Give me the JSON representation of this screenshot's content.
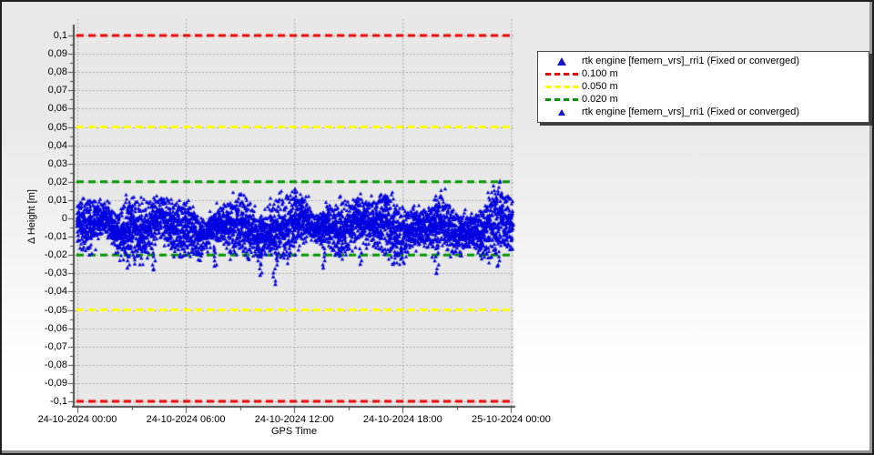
{
  "chart_data": {
    "type": "scatter",
    "title": "",
    "xlabel": "GPS Time",
    "ylabel": "Δ Height [m]",
    "x_ticks": [
      "24-10-2024 00:00",
      "24-10-2024 06:00",
      "24-10-2024 12:00",
      "24-10-2024 18:00",
      "25-10-2024 00:00"
    ],
    "x_range_hours": 24,
    "y_ticks": [
      "0,1",
      "0,09",
      "0,08",
      "0,07",
      "0,06",
      "0,05",
      "0,04",
      "0,03",
      "0,02",
      "0,01",
      "0",
      "-0,01",
      "-0,02",
      "-0,03",
      "-0,04",
      "-0,05",
      "-0,06",
      "-0,07",
      "-0,08",
      "-0,09",
      "-0,1"
    ],
    "ylim": [
      -0.1,
      0.1
    ],
    "y_step": 0.01,
    "grid": "dashed",
    "plot_bg": "#e8e8e8",
    "grid_color": "#a9a9a9",
    "axis_color": "#4d4d4d",
    "thresholds": [
      {
        "value": 0.1,
        "color": "#f00000",
        "label": "0.100 m"
      },
      {
        "value": 0.05,
        "color": "#ffff00",
        "label": "0.050 m"
      },
      {
        "value": 0.02,
        "color": "#009600",
        "label": "0.020 m"
      },
      {
        "value": -0.02,
        "color": "#009600",
        "label": "0.020 m"
      },
      {
        "value": -0.05,
        "color": "#ffff00",
        "label": "0.050 m"
      },
      {
        "value": -0.1,
        "color": "#f00000",
        "label": "0.100 m"
      }
    ],
    "series": [
      {
        "name": "rtk engine [femern_vrs]_rri1 (Fixed or converged)",
        "marker": "triangle",
        "color": "#0000e0",
        "summary": {
          "description": "Dense 24 h noise band of RTK height residuals, mostly between +0.010 m and -0.020 m, centered near -0.005 m",
          "mean": -0.005,
          "typical_spread": 0.011,
          "min": -0.036,
          "max": 0.018
        },
        "band": {
          "center": -0.0045,
          "halfwidth": 0.0105,
          "points_per_column": 7,
          "seed": 1337
        },
        "outliers": [
          {
            "t": 0.115,
            "v": -0.027
          },
          {
            "t": 0.175,
            "v": -0.028
          },
          {
            "t": 0.315,
            "v": -0.026
          },
          {
            "t": 0.42,
            "v": -0.031
          },
          {
            "t": 0.455,
            "v": -0.036
          },
          {
            "t": 0.5,
            "v": 0.016
          },
          {
            "t": 0.565,
            "v": -0.027
          },
          {
            "t": 0.65,
            "v": -0.025
          },
          {
            "t": 0.825,
            "v": -0.03
          },
          {
            "t": 0.965,
            "v": -0.026
          }
        ]
      }
    ],
    "legend": {
      "entries": [
        {
          "marker": "triangle",
          "color": "#1717c9",
          "label": "rtk engine [femern_vrs]_rri1 (Fixed or converged)"
        },
        {
          "marker": "dash",
          "color": "#f00000",
          "label": "0.100 m"
        },
        {
          "marker": "dash",
          "color": "#ffff00",
          "label": "0.050 m"
        },
        {
          "marker": "dash",
          "color": "#009600",
          "label": "0.020 m"
        },
        {
          "marker": "triangle",
          "color": "#1717c9",
          "label": "rtk engine [femern_vrs]_rri1 (Fixed or converged)"
        }
      ]
    }
  }
}
